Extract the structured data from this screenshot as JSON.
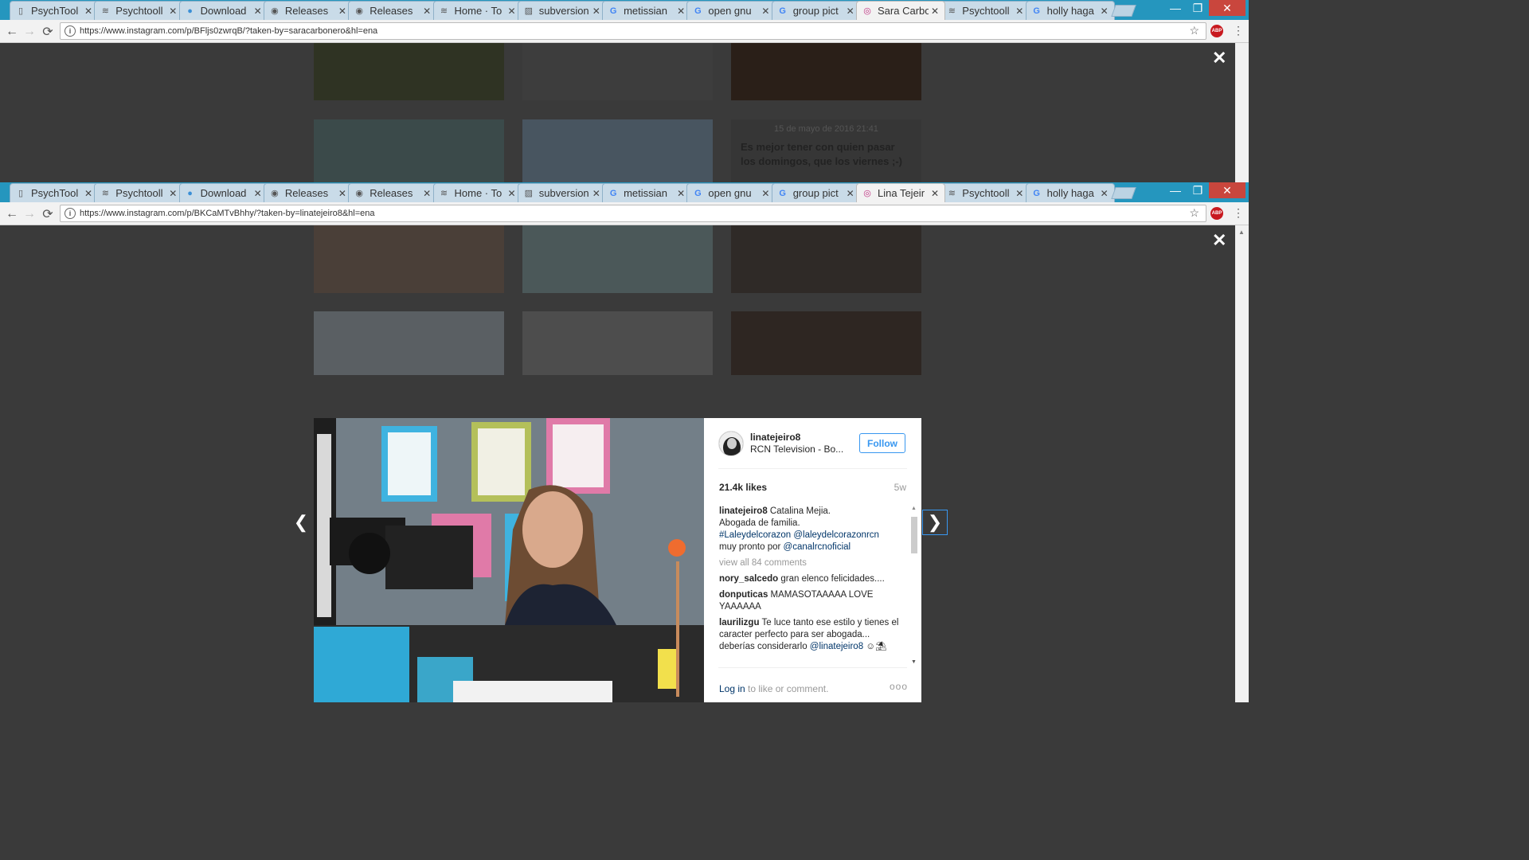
{
  "window1": {
    "tabs": [
      {
        "label": "PsychTool",
        "icon": "page-icon"
      },
      {
        "label": "Psychtooll",
        "icon": "wave-icon"
      },
      {
        "label": "Download",
        "icon": "circle-icon"
      },
      {
        "label": "Releases",
        "icon": "github-icon"
      },
      {
        "label": "Releases",
        "icon": "github-icon"
      },
      {
        "label": "Home · To",
        "icon": "wave-icon"
      },
      {
        "label": "subversion",
        "icon": "image-icon"
      },
      {
        "label": "metissian",
        "icon": "google-icon"
      },
      {
        "label": "open gnu",
        "icon": "google-icon"
      },
      {
        "label": "group pict",
        "icon": "google-icon"
      },
      {
        "label": "Sara Carbo",
        "icon": "instagram-icon"
      },
      {
        "label": "Psychtooll",
        "icon": "wave-icon"
      },
      {
        "label": "holly haga",
        "icon": "google-icon"
      }
    ],
    "active_tab": 10,
    "url": "https://www.instagram.com/p/BFljs0zwrqB/?taken-by=saracarbonero&hl=ena",
    "post_date": "15 de mayo de 2016 21:41",
    "post_caption": "Es mejor tener con quien pasar los domingos, que los viernes ;-)"
  },
  "window2": {
    "tabs": [
      {
        "label": "PsychTool",
        "icon": "page-icon"
      },
      {
        "label": "Psychtooll",
        "icon": "wave-icon"
      },
      {
        "label": "Download",
        "icon": "circle-icon"
      },
      {
        "label": "Releases",
        "icon": "github-icon"
      },
      {
        "label": "Releases",
        "icon": "github-icon"
      },
      {
        "label": "Home · To",
        "icon": "wave-icon"
      },
      {
        "label": "subversion",
        "icon": "image-icon"
      },
      {
        "label": "metissian",
        "icon": "google-icon"
      },
      {
        "label": "open gnu",
        "icon": "google-icon"
      },
      {
        "label": "group pict",
        "icon": "google-icon"
      },
      {
        "label": "Lina Tejeir",
        "icon": "instagram-icon"
      },
      {
        "label": "Psychtooll",
        "icon": "wave-icon"
      },
      {
        "label": "holly haga",
        "icon": "google-icon"
      }
    ],
    "active_tab": 10,
    "url": "https://www.instagram.com/p/BKCaMTvBhhy/?taken-by=linatejeiro8&hl=ena"
  },
  "post": {
    "username": "linatejeiro8",
    "location": "RCN Television - Bo...",
    "follow_label": "Follow",
    "likes": "21.4k likes",
    "age": "5w",
    "caption_user": "linatejeiro8",
    "caption_line1": "Catalina Mejia.",
    "caption_line2": "Abogada de familia.",
    "caption_tag1": "#Laleydelcorazon",
    "caption_tag2": "@laleydelcorazonrcn",
    "caption_line4": "muy pronto por ",
    "caption_tag3": "@canalrcnoficial",
    "view_all": "view all 84 comments",
    "comments": [
      {
        "user": "nory_salcedo",
        "text": "gran elenco felicidades...."
      },
      {
        "user": "donputicas",
        "text": "MAMASOTAAAAA LOVE YAAAAAA"
      },
      {
        "user": "laurilizgu",
        "text": "Te luce tanto ese estilo y tienes el caracter perfecto para ser abogada... deberías considerarlo",
        "mention": "@linatejeiro8",
        "emoji": "☺⛱"
      }
    ],
    "login_link": "Log in",
    "login_rest": " to like or comment.",
    "more": "ooo"
  },
  "colors": {
    "accent": "#3897f0",
    "tabstrip": "#2596be",
    "overlay": "#3a3a3a"
  }
}
